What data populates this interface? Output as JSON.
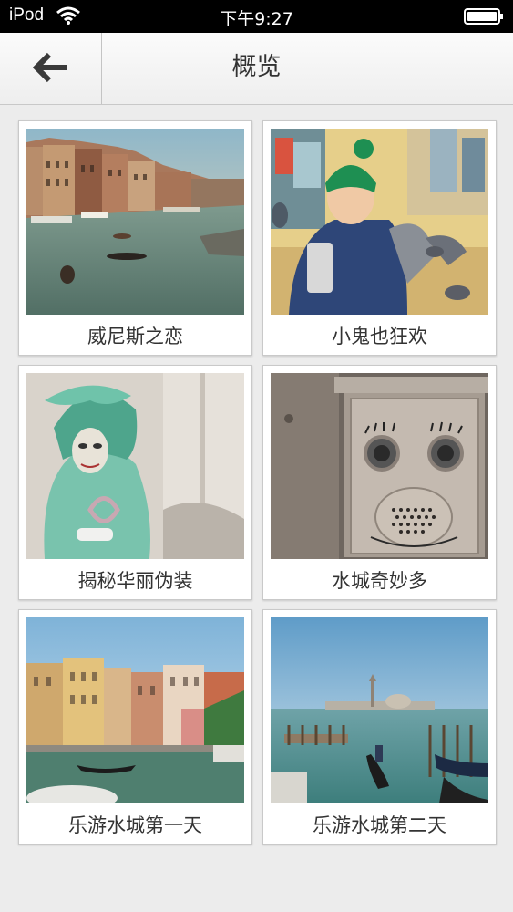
{
  "status_bar": {
    "carrier": "iPod",
    "time": "下午9:27",
    "wifi_icon": "wifi-icon",
    "battery_icon": "battery-icon"
  },
  "nav": {
    "title": "概览",
    "back_icon": "back-arrow-icon"
  },
  "cards": [
    {
      "label": "威尼斯之恋",
      "image": "venice-grand-canal-photo"
    },
    {
      "label": "小鬼也狂欢",
      "image": "child-with-pigeons-photo"
    },
    {
      "label": "揭秘华丽伪装",
      "image": "carnival-mask-costume-photo"
    },
    {
      "label": "水城奇妙多",
      "image": "funny-face-doorbell-photo"
    },
    {
      "label": "乐游水城第一天",
      "image": "venice-colorful-houses-photo"
    },
    {
      "label": "乐游水城第二天",
      "image": "venice-gondolas-lagoon-photo"
    }
  ],
  "colors": {
    "background": "#ececec",
    "status_bar": "#000000",
    "text": "#333333"
  }
}
